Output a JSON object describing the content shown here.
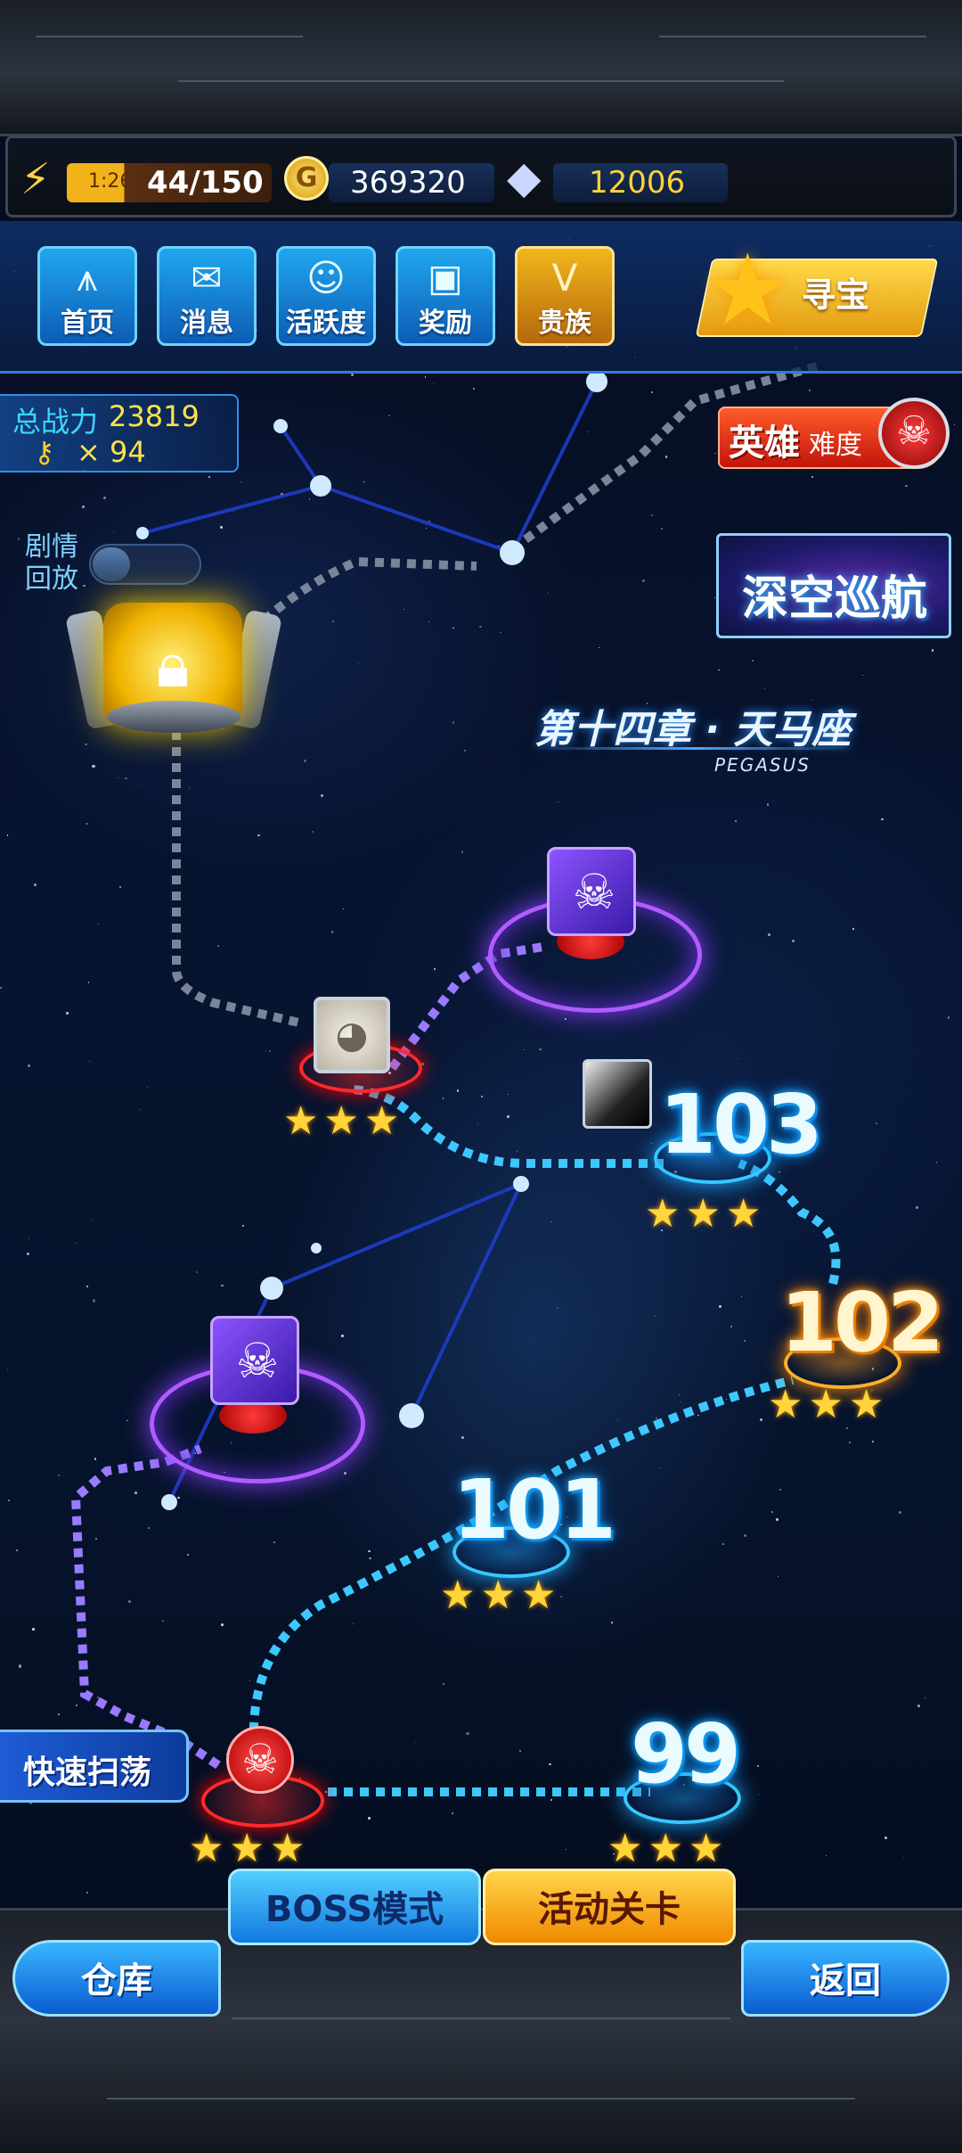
{
  "resources": {
    "energy_timer": "1:26",
    "energy": "44/150",
    "gold": "369320",
    "diamonds": "12006"
  },
  "nav": {
    "home": "首页",
    "messages": "消息",
    "activity": "活跃度",
    "rewards": "奖励",
    "noble": "贵族",
    "treasure": "寻宝"
  },
  "stats": {
    "power_label": "总战力",
    "power_value": "23819",
    "keys": "× 94"
  },
  "difficulty": {
    "hero": "英雄",
    "suffix": "难度"
  },
  "deep_space": "深空巡航",
  "replay": {
    "line1": "剧情",
    "line2": "回放"
  },
  "chapter": {
    "title": "第十四章 · 天马座",
    "subtitle": "PEGASUS"
  },
  "levels": {
    "l99": "99",
    "l101": "101",
    "l102": "102",
    "l103": "103",
    "stars": "★★★"
  },
  "buttons": {
    "quick_sweep": "快速扫荡",
    "boss_mode": "BOSS模式",
    "event_stage": "活动关卡",
    "warehouse": "仓库",
    "back": "返回"
  },
  "colors": {
    "path_cyan": "#3ec8ff",
    "path_purple": "#9a7bff",
    "boss_purple": "#8c54ff",
    "star_gold": "#ffd53a"
  }
}
